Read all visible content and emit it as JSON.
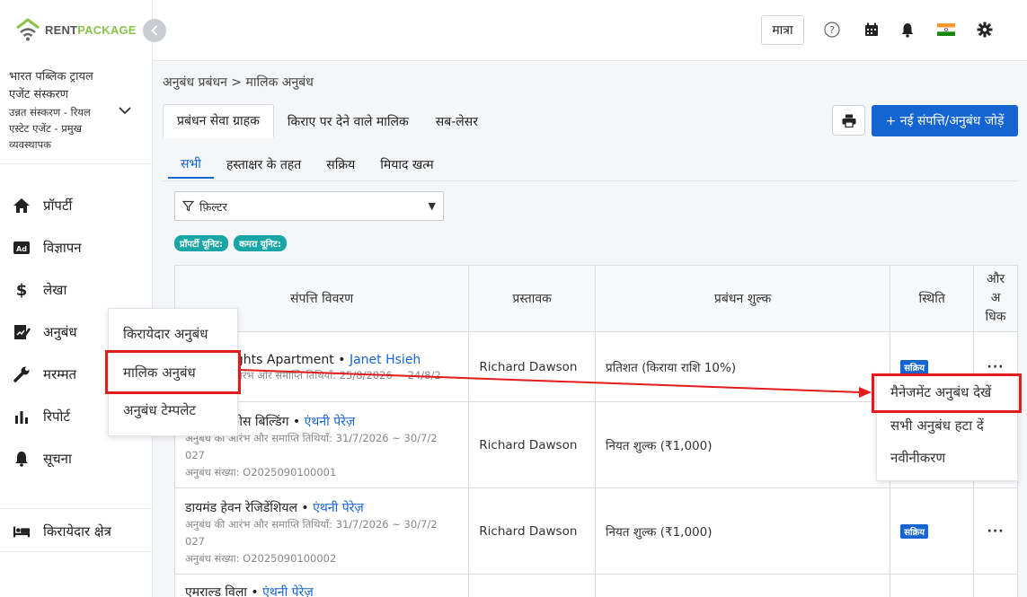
{
  "logo": {
    "part1": "RENT",
    "part2": "PACKAGE"
  },
  "org": {
    "name_line1": "भारत पब्लिक ट्रायल",
    "name_line2": "एजेंट संस्करण",
    "role_line1": "उन्नत संस्करण - रियल",
    "role_line2": "एस्टेट एजेंट - प्रमुख",
    "role_line3": "व्यवस्थापक"
  },
  "sidebar": {
    "items": [
      {
        "label": "प्रॉपर्टी",
        "icon": "home-icon"
      },
      {
        "label": "विज्ञापन",
        "icon": "ad-icon"
      },
      {
        "label": "लेखा",
        "icon": "dollar-icon"
      },
      {
        "label": "अनुबंध",
        "icon": "contract-icon"
      },
      {
        "label": "मरम्मत",
        "icon": "wrench-icon"
      },
      {
        "label": "रिपोर्ट",
        "icon": "bar-chart-icon"
      },
      {
        "label": "सूचना",
        "icon": "bell-icon"
      }
    ],
    "tenant_area": "किरायेदार क्षेत्र"
  },
  "topbar": {
    "qty_label": "मात्रा",
    "icons": [
      "help-icon",
      "calendar-icon",
      "notification-bell-icon",
      "india-flag-icon",
      "settings-gear-icon"
    ]
  },
  "breadcrumb": "अनुबंध प्रबंधन > मालिक अनुबंध",
  "primary_tabs": [
    "प्रबंधन सेवा ग्राहक",
    "किराए पर देने वाले मालिक",
    "सब-लेसर"
  ],
  "add_button": "+ नई संपत्ति/अनुबंध जोड़ें",
  "secondary_tabs": [
    "सभी",
    "हस्ताक्षर के तहत",
    "सक्रिय",
    "मियाद खत्म"
  ],
  "filter": {
    "label": "फ़िल्टर"
  },
  "chips": [
    "प्रॉपर्टी यूनिट:",
    "कमरा यूनिट:"
  ],
  "table": {
    "headers": {
      "property": "संपत्ति विवरण",
      "proposer": "प्रस्तावक",
      "fee": "प्रबंधन शुल्क",
      "status": "स्थिति",
      "more_1": "और",
      "more_2": "अ",
      "more_3": "धिक"
    },
    "rows": [
      {
        "name": "ights Apartment",
        "sep": " • ",
        "agent": "Janet Hsieh",
        "meta1": "आरंभ और समाप्ति तिथियाँ: 25/8/2026 ~ 24/8/2",
        "meta2": "",
        "meta3": "",
        "proposer": "Richard Dawson",
        "fee": "प्रतिशत (किराया राशि 10%)",
        "status": "सक्रिय"
      },
      {
        "name": "ीस बिल्डिंग",
        "sep": " • ",
        "agent": "एंथनी पेरेज़",
        "meta1": "अनुबंध की आरंभ और समाप्ति तिथियाँ: 31/7/2026 ~ 30/7/2",
        "meta2": "027",
        "meta3": "अनुबंध संख्या: O2025090100001",
        "proposer": "Richard Dawson",
        "fee": "नियत शुल्क (₹1,000)",
        "status": ""
      },
      {
        "name": "डायमंड हेवन रेजिडेंशियल",
        "sep": " • ",
        "agent": "एंथनी पेरेज़",
        "meta1": "अनुबंध की आरंभ और समाप्ति तिथियाँ: 31/7/2026 ~ 30/7/2",
        "meta2": "027",
        "meta3": "अनुबंध संख्या: O2025090100002",
        "proposer": "Richard Dawson",
        "fee": "नियत शुल्क (₹1,000)",
        "status": "सक्रिय"
      },
      {
        "name": "एमराल्ड विला",
        "sep": " • ",
        "agent": "एंथनी पेरेज़",
        "meta1": "",
        "meta2": "",
        "meta3": "",
        "proposer": "",
        "fee": "",
        "status": ""
      }
    ],
    "more_label": "···"
  },
  "contract_menu": [
    "किरायेदार अनुबंध",
    "मालिक अनुबंध",
    "अनुबंध टेम्पलेट"
  ],
  "row_action_menu": [
    "मैनेजमेंट अनुबंध देखें",
    "सभी अनुबंध हटा दें",
    "नवीनीकरण"
  ],
  "colors": {
    "primary": "#1464d2",
    "highlight": "#e31b1b",
    "chip": "#1aa6a6",
    "logo_green": "#8bc34a"
  }
}
